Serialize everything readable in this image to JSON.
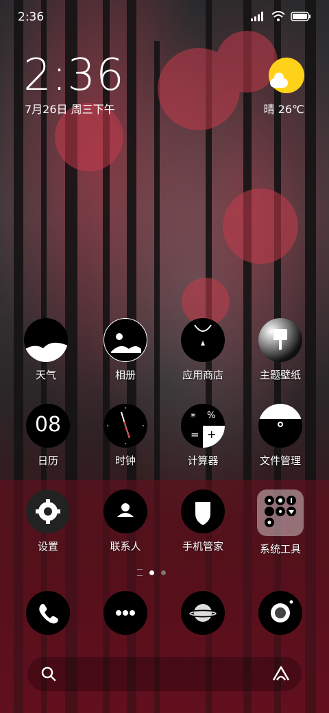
{
  "status": {
    "time": "2:36"
  },
  "clock": {
    "time": "2:36",
    "date": "7月26日 周三下午"
  },
  "weather": {
    "text": "晴 26℃",
    "sun_color": "#ffd21a"
  },
  "apps": [
    {
      "label": "天气",
      "icon": "weather-icon"
    },
    {
      "label": "相册",
      "icon": "gallery-icon"
    },
    {
      "label": "应用商店",
      "icon": "app-store-icon"
    },
    {
      "label": "主题壁纸",
      "icon": "themes-icon"
    },
    {
      "label": "日历",
      "icon": "calendar-icon",
      "value": "08"
    },
    {
      "label": "时钟",
      "icon": "clock-icon"
    },
    {
      "label": "计算器",
      "icon": "calculator-icon",
      "symbols": [
        "*",
        "%",
        "=",
        "+"
      ]
    },
    {
      "label": "文件管理",
      "icon": "file-manager-icon"
    },
    {
      "label": "设置",
      "icon": "settings-icon"
    },
    {
      "label": "联系人",
      "icon": "contacts-icon"
    },
    {
      "label": "手机管家",
      "icon": "security-icon"
    },
    {
      "label": "系统工具",
      "icon": "system-tools-folder-icon"
    }
  ],
  "pages": {
    "count": 2,
    "current": 1
  },
  "dock": [
    {
      "icon": "phone-icon"
    },
    {
      "icon": "messages-icon"
    },
    {
      "icon": "browser-icon"
    },
    {
      "icon": "camera-icon"
    }
  ],
  "search": {
    "icons": [
      "search-icon",
      "assistant-icon"
    ]
  }
}
